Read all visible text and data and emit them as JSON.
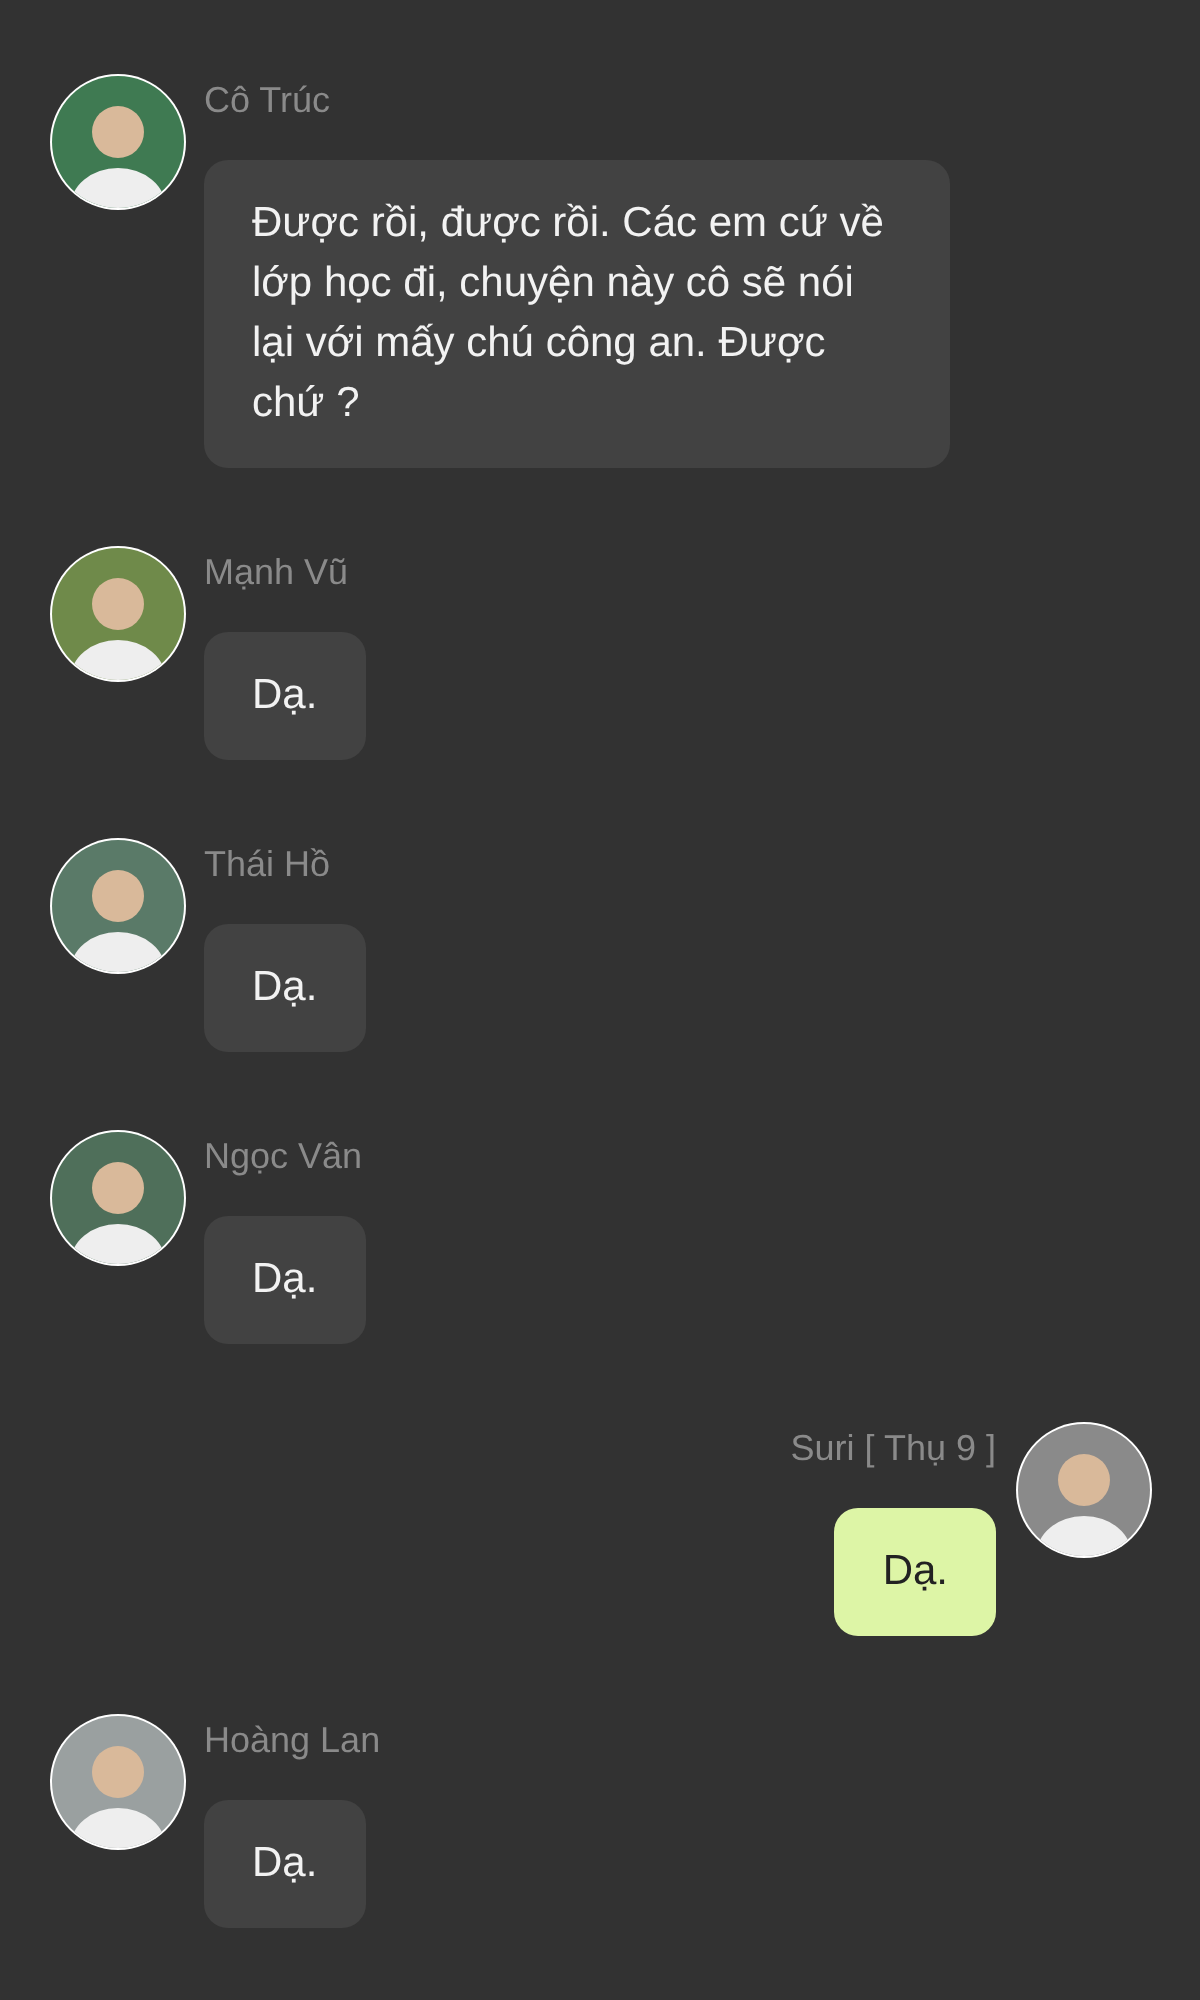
{
  "messages": [
    {
      "sender": "Cô Trúc",
      "text": "Được rồi, được rồi. Các em cứ về lớp học đi, chuyện này cô sẽ nói lại với mấy chú công an. Được chứ ?",
      "outgoing": false,
      "color": "#3f7a52"
    },
    {
      "sender": "Mạnh Vũ",
      "text": "Dạ.",
      "outgoing": false,
      "color": "#6f8a4a"
    },
    {
      "sender": "Thái Hồ",
      "text": "Dạ.",
      "outgoing": false,
      "color": "#5a7a68"
    },
    {
      "sender": "Ngọc Vân",
      "text": "Dạ.",
      "outgoing": false,
      "color": "#4f6f5a"
    },
    {
      "sender": "Suri [ Thụ 9 ]",
      "text": "Dạ.",
      "outgoing": true,
      "color": "#8a8a8a"
    },
    {
      "sender": "Hoàng Lan",
      "text": "Dạ.",
      "outgoing": false,
      "color": "#9aa0a0"
    }
  ]
}
